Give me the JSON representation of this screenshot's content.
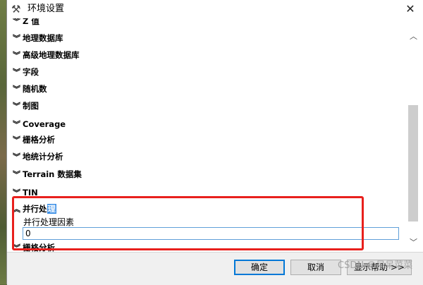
{
  "window": {
    "title": "环境设置",
    "close_glyph": "✕",
    "app_icon": "tools-icon"
  },
  "categories": [
    {
      "label": "Z 值",
      "chevron": "double-chevron-down",
      "partially_visible": true
    },
    {
      "label": "地理数据库",
      "chevron": "double-chevron-down"
    },
    {
      "label": "高级地理数据库",
      "chevron": "double-chevron-down"
    },
    {
      "label": "字段",
      "chevron": "double-chevron-down"
    },
    {
      "label": "随机数",
      "chevron": "double-chevron-down"
    },
    {
      "label": "制图",
      "chevron": "double-chevron-down"
    },
    {
      "label": "Coverage",
      "chevron": "double-chevron-down"
    },
    {
      "label": "栅格分析",
      "chevron": "double-chevron-down"
    },
    {
      "label": "地统计分析",
      "chevron": "double-chevron-down"
    },
    {
      "label": "Terrain 数据集",
      "chevron": "double-chevron-down"
    },
    {
      "label": "TIN",
      "chevron": "double-chevron-down"
    }
  ],
  "expanded_category": {
    "label_plain": "并行处",
    "label_selected": "理",
    "chevron": "double-chevron-up",
    "setting_label": "并行处理因素",
    "setting_value": "0"
  },
  "partial_next_category": "栅格分析",
  "buttons": {
    "ok": "确定",
    "cancel": "取消",
    "help": "显示帮助 >>"
  },
  "watermark": "CSDN @呆呆菜菜",
  "colors": {
    "highlight_box": "#e8201d",
    "selection": "#3a8ee6",
    "focus_border": "#0078d7"
  }
}
